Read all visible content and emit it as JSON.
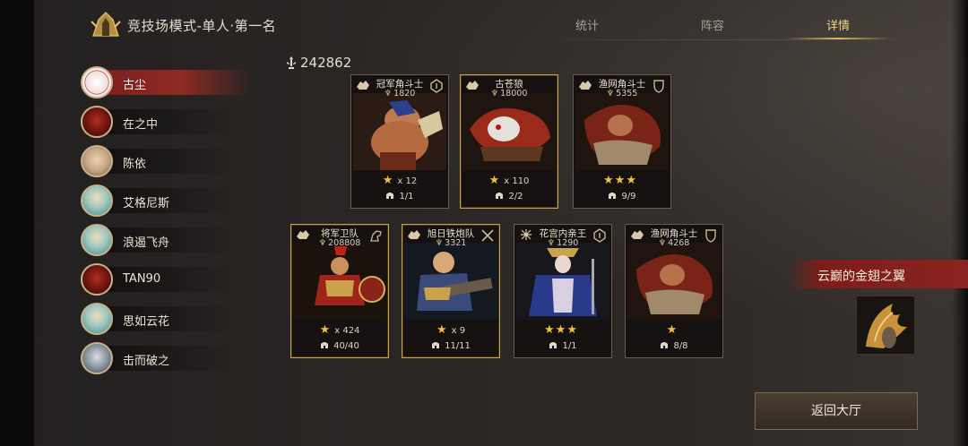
{
  "header": {
    "title": "竞技场模式-单人·第一名",
    "tabs": [
      {
        "label": "统计",
        "active": false
      },
      {
        "label": "阵容",
        "active": false
      },
      {
        "label": "详情",
        "active": true
      }
    ]
  },
  "players": [
    {
      "name": "古尘",
      "selected": true
    },
    {
      "name": "在之中",
      "selected": false
    },
    {
      "name": "陈依",
      "selected": false
    },
    {
      "name": "艾格尼斯",
      "selected": false
    },
    {
      "name": "浪遏飞舟",
      "selected": false
    },
    {
      "name": "TAN90",
      "selected": false
    },
    {
      "name": "思如云花",
      "selected": false
    },
    {
      "name": "击而破之",
      "selected": false
    }
  ],
  "power": "242862",
  "units": [
    {
      "name": "冠军角斗士",
      "cost": "1820",
      "stars_text": "★",
      "stars_mult": "x 12",
      "count": "1/1",
      "border": "dark"
    },
    {
      "name": "古苍狼",
      "cost": "18000",
      "stars_text": "★",
      "stars_mult": "x 110",
      "count": "2/2",
      "border": "gold"
    },
    {
      "name": "渔网角斗士",
      "cost": "5355",
      "stars_text": "★★★",
      "stars_mult": "",
      "count": "9/9",
      "border": "dark"
    },
    {
      "name": "将军卫队",
      "cost": "208808",
      "stars_text": "★",
      "stars_mult": "x 424",
      "count": "40/40",
      "border": "gold"
    },
    {
      "name": "旭日铁炮队",
      "cost": "3321",
      "stars_text": "★",
      "stars_mult": "x 9",
      "count": "11/11",
      "border": "gold"
    },
    {
      "name": "花宫内亲王",
      "cost": "1290",
      "stars_text": "★★★",
      "stars_mult": "",
      "count": "1/1",
      "border": "dark"
    },
    {
      "name": "渔网角斗士",
      "cost": "4268",
      "stars_text": "★",
      "stars_mult": "",
      "count": "8/8",
      "border": "dark"
    }
  ],
  "relic": {
    "title": "云巅的金翅之翼"
  },
  "return_button": "返回大厅",
  "colors": {
    "accent_gold": "#d9b45e",
    "selected_red": "#8f2a22",
    "star_yellow": "#f0c040"
  }
}
